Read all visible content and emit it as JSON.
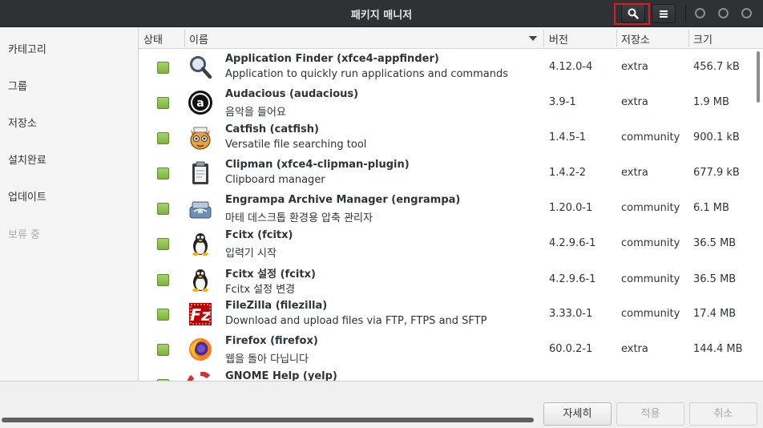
{
  "window": {
    "title": "패키지 매니저"
  },
  "header": {
    "search_icon": "search-icon",
    "menu_icon": "hamburger-menu-icon"
  },
  "sidebar": {
    "items": [
      {
        "label": "카테고리",
        "enabled": true
      },
      {
        "label": "그룹",
        "enabled": true
      },
      {
        "label": "저장소",
        "enabled": true
      },
      {
        "label": "설치완료",
        "enabled": true
      },
      {
        "label": "업데이트",
        "enabled": true
      },
      {
        "label": "보류 중",
        "enabled": false
      }
    ]
  },
  "table": {
    "columns": {
      "state": "상태",
      "name": "이름",
      "version": "버전",
      "repo": "저장소",
      "size": "크기"
    },
    "rows": [
      {
        "name": "Application Finder  (xfce4-appfinder)",
        "desc": "Application to quickly run applications and commands",
        "version": "4.12.0-4",
        "repo": "extra",
        "size": "456.7 kB",
        "icon": "magnifier-icon"
      },
      {
        "name": "Audacious  (audacious)",
        "desc": "음악을 들어요",
        "version": "3.9-1",
        "repo": "extra",
        "size": "1.9 MB",
        "icon": "audacious-icon"
      },
      {
        "name": "Catfish  (catfish)",
        "desc": "Versatile file searching tool",
        "version": "1.4.5-1",
        "repo": "community",
        "size": "900.1 kB",
        "icon": "catfish-icon"
      },
      {
        "name": "Clipman  (xfce4-clipman-plugin)",
        "desc": "Clipboard manager",
        "version": "1.4.2-2",
        "repo": "extra",
        "size": "677.9 kB",
        "icon": "clipboard-icon"
      },
      {
        "name": "Engrampa Archive Manager  (engrampa)",
        "desc": "마테 데스크톱 환경용 압축 관리자",
        "version": "1.20.0-1",
        "repo": "community",
        "size": "6.1 MB",
        "icon": "archive-icon"
      },
      {
        "name": "Fcitx  (fcitx)",
        "desc": "입력기 시작",
        "version": "4.2.9.6-1",
        "repo": "community",
        "size": "36.5 MB",
        "icon": "tux-penguin-icon"
      },
      {
        "name": "Fcitx 설정  (fcitx)",
        "desc": "Fcitx 설정 변경",
        "version": "4.2.9.6-1",
        "repo": "community",
        "size": "36.5 MB",
        "icon": "tux-penguin-icon"
      },
      {
        "name": "FileZilla  (filezilla)",
        "desc": "Download and upload files via FTP, FTPS and SFTP",
        "version": "3.33.0-1",
        "repo": "community",
        "size": "17.4 MB",
        "icon": "filezilla-icon"
      },
      {
        "name": "Firefox  (firefox)",
        "desc": "웹을 돌아 다닙니다",
        "version": "60.0.2-1",
        "repo": "extra",
        "size": "144.4 MB",
        "icon": "firefox-icon"
      },
      {
        "name": "GNOME Help  (yelp)",
        "desc": "",
        "version": "",
        "repo": "",
        "size": "",
        "icon": "help-icon"
      }
    ]
  },
  "footer": {
    "details": "자세히",
    "apply": "적용",
    "cancel": "취소"
  }
}
